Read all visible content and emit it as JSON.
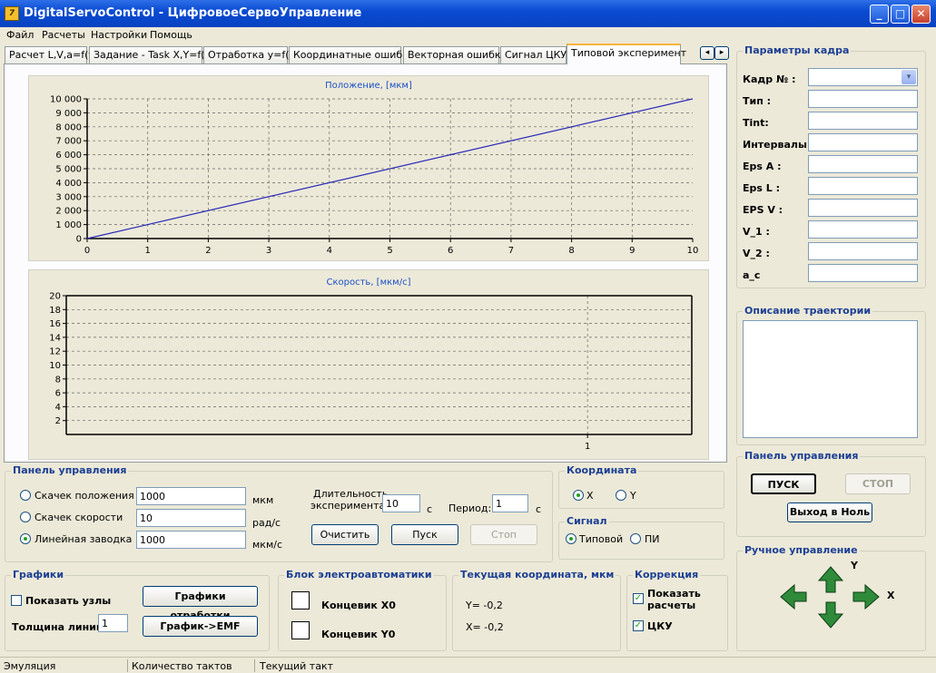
{
  "window": {
    "title": "DigitalServoControl - ЦифровоеСервоУправление",
    "icon_label": "7"
  },
  "menu": [
    "Файл",
    "Расчеты",
    "Настройки",
    "Помощь"
  ],
  "tabs": [
    "Расчет L,V,a=f(t)",
    "Задание - Task X,Y=f(t)",
    "Отработка y=f(x)",
    "Координатные ошибки",
    "Векторная ошибка",
    "Сигнал ЦКУ",
    "Типовой эксперимент"
  ],
  "tab_scroll": [
    "◂",
    "▸"
  ],
  "chart_data": [
    {
      "type": "line",
      "title": "Положение, [мкм]",
      "x": [
        0,
        10
      ],
      "y": [
        0,
        10000
      ],
      "xlim": [
        0,
        10
      ],
      "ylim": [
        0,
        10000
      ],
      "xticks": [
        "0",
        "1",
        "2",
        "3",
        "4",
        "5",
        "6",
        "7",
        "8",
        "9",
        "10"
      ],
      "yticks": [
        "0",
        "1 000",
        "2 000",
        "3 000",
        "4 000",
        "5 000",
        "6 000",
        "7 000",
        "8 000",
        "9 000",
        "10 000"
      ],
      "grid": true,
      "line_color": "#2a2ab8"
    },
    {
      "type": "line",
      "title": "Скорость, [мкм/с]",
      "x": [],
      "y": [],
      "xlim": [
        0,
        1.2
      ],
      "ylim": [
        0,
        20
      ],
      "xticks": [
        "1"
      ],
      "yticks": [
        "2",
        "4",
        "6",
        "8",
        "10",
        "12",
        "14",
        "16",
        "18",
        "20"
      ],
      "grid": true
    }
  ],
  "control_panel": {
    "title": "Панель управления",
    "options": [
      {
        "label": "Скачек положения",
        "value": "1000",
        "unit": "мкм",
        "selected": false
      },
      {
        "label": "Скачек скорости",
        "value": "10",
        "unit": "рад/с",
        "selected": false
      },
      {
        "label": "Линейная заводка",
        "value": "1000",
        "unit": "мкм/с",
        "selected": true
      }
    ],
    "duration_label_1": "Длительность",
    "duration_label_2": "эксперимента:",
    "duration_value": "10",
    "duration_unit": "с",
    "period_label": "Период:",
    "period_value": "1",
    "period_unit": "с",
    "clear_btn": "Очистить",
    "start_btn": "Пуск",
    "stop_btn": "Стоп"
  },
  "coordinate": {
    "title": "Координата",
    "x_label": "X",
    "y_label": "Y",
    "selected": "X"
  },
  "signal": {
    "title": "Сигнал",
    "typical": "Типовой",
    "pi": "ПИ",
    "selected": "Типовой"
  },
  "graphs": {
    "title": "Графики",
    "show_nodes": "Показать узлы",
    "line_width_label": "Толщина линий",
    "line_width_value": "1",
    "graphs_btn": "Графики отработки",
    "emf_btn": "График->EMF"
  },
  "electro": {
    "title": "Блок электроавтоматики",
    "x0": "Концевик X0",
    "y0": "Концевик Y0"
  },
  "current": {
    "title": "Текущая координата, мкм",
    "y": "Y= -0,2",
    "x": "X= -0,2"
  },
  "correction": {
    "title": "Коррекция",
    "show_calc_1": "Показать",
    "show_calc_2": "расчеты",
    "cku": "ЦКУ"
  },
  "frame": {
    "title": "Параметры кадра",
    "fields": [
      "Кадр № :",
      "Тип :",
      "Tint:",
      "Интервалы :",
      "Eps A :",
      "Eps L :",
      "EPS V :",
      "V_1 :",
      "V_2 :",
      "a_c"
    ]
  },
  "trajectory": {
    "title": "Описание траектории"
  },
  "right_panel": {
    "title": "Панель управления",
    "start": "ПУСК",
    "stop": "СТОП",
    "home": "Выход в Ноль"
  },
  "manual": {
    "title": "Ручное управление",
    "y_label": "Y",
    "x_label": "X",
    "arrow_color": "#2f8a3a"
  },
  "status": [
    "Эмуляция",
    "Количество тактов",
    "Текущий такт"
  ]
}
